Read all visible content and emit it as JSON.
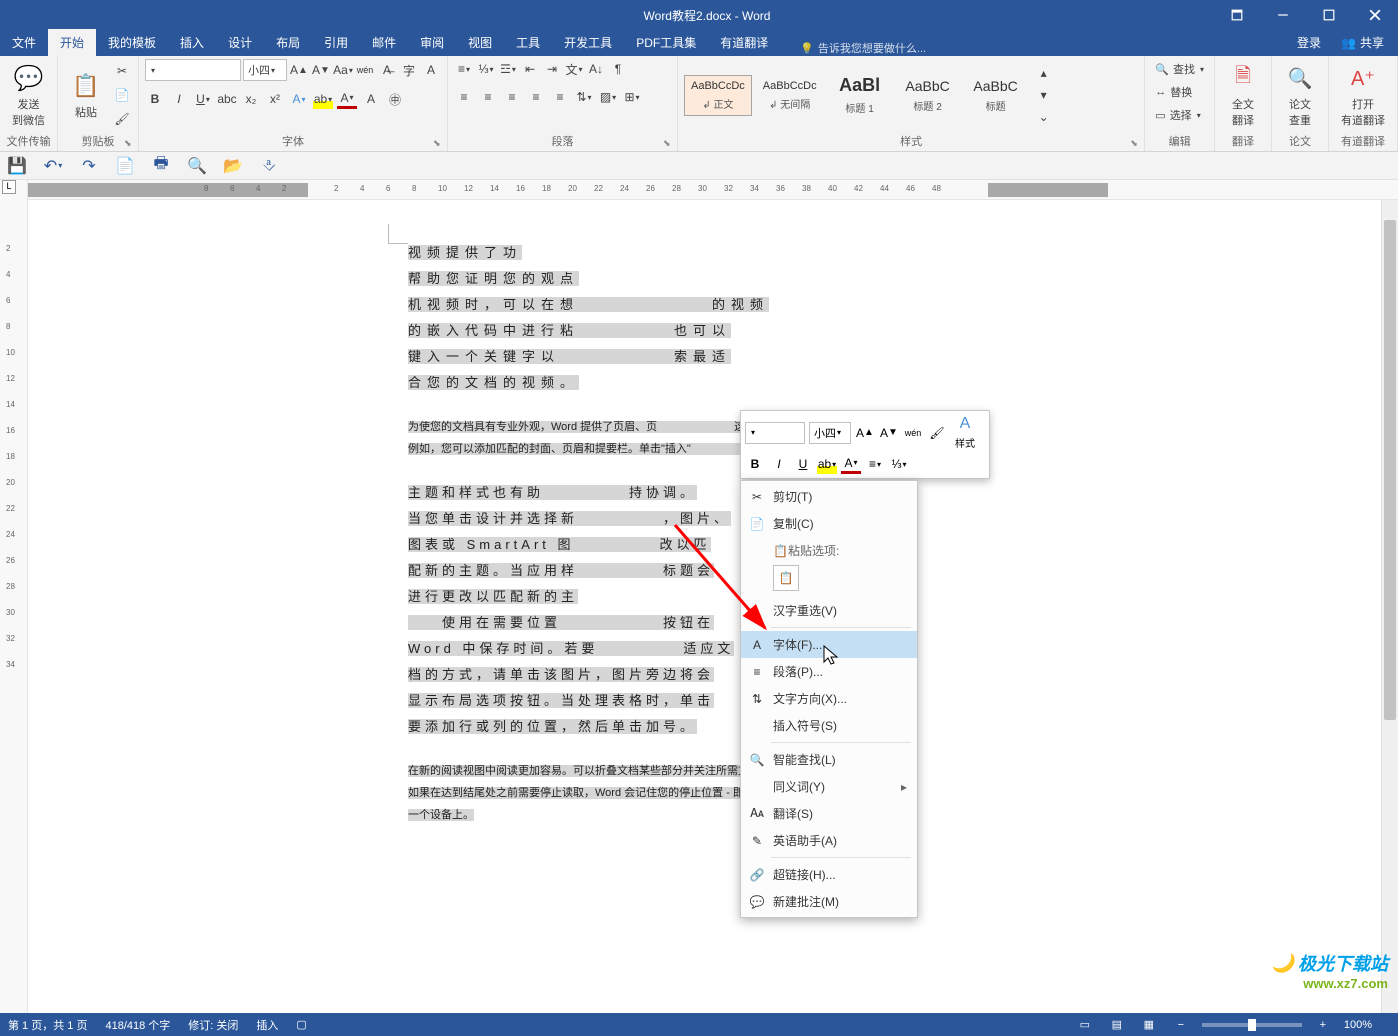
{
  "title": "Word教程2.docx - Word",
  "tabs": {
    "file": "文件",
    "home": "开始",
    "templates": "我的模板",
    "insert": "插入",
    "design": "设计",
    "layout": "布局",
    "references": "引用",
    "mailings": "邮件",
    "review": "审阅",
    "view": "视图",
    "tools": "工具",
    "devtools": "开发工具",
    "pdf": "PDF工具集",
    "youdao": "有道翻译"
  },
  "tell_me": "告诉我您想要做什么...",
  "login": "登录",
  "share": "共享",
  "ribbon": {
    "send_wechat": "发送\n到微信",
    "file_transfer": "文件传输",
    "paste": "粘贴",
    "clipboard": "剪贴板",
    "font_name": "",
    "font_size": "小四",
    "font_group": "字体",
    "para_group": "段落",
    "style_group": "样式",
    "edit_group": "编辑",
    "fulltext_trans": "全文\n翻译",
    "thesis_check": "论文\n查重",
    "open_youdao": "打开\n有道翻译",
    "translate": "翻译",
    "thesis": "论文",
    "youdao_grp": "有道翻译",
    "find": "查找",
    "replace": "替换",
    "select": "选择",
    "styles": {
      "normal": {
        "preview": "AaBbCcDc",
        "name": "↲ 正文"
      },
      "nospace": {
        "preview": "AaBbCcDc",
        "name": "↲ 无间隔"
      },
      "h1": {
        "preview": "AaBl",
        "name": "标题 1"
      },
      "h2": {
        "preview": "AaBbC",
        "name": "标题 2"
      },
      "title": {
        "preview": "AaBbC",
        "name": "标题"
      }
    }
  },
  "mini": {
    "font_name": "",
    "font_size": "小四",
    "styles_label": "样式"
  },
  "context_menu": {
    "cut": "剪切(T)",
    "copy": "复制(C)",
    "paste_options": "粘贴选项:",
    "han_reselect": "汉字重选(V)",
    "font": "字体(F)...",
    "paragraph": "段落(P)...",
    "text_direction": "文字方向(X)...",
    "insert_symbol": "插入符号(S)",
    "smart_lookup": "智能查找(L)",
    "synonyms": "同义词(Y)",
    "translate": "翻译(S)",
    "english_assistant": "英语助手(A)",
    "hyperlink": "超链接(H)...",
    "new_comment": "新建批注(M)"
  },
  "doc": {
    "p1": "视频提供了功\n帮助您证明您的观点\n机视频时，可以在想　　　　　　　的视频\n的嵌入代码中进行粘　　　　　也可以\n键入一个关键字以　　　　　　索最适\n合您的文档的视频。",
    "p2": "为使您的文档具有专业外观，Word 提供了页眉、页　　　　　　　这些设计可互为补充。\n例如，您可以添加匹配的封面、页眉和提要栏。单击\"插入\"　　　　　　　所需元素。",
    "p3": "主题和样式也有助　　　　　持协调。\n当您单击设计并选择新　　　　　，图片、\n图表或 SmartArt 图　　　　　改以匹\n配新的主题。当应用样　　　　　标题会\n进行更改以匹配新的主\n　　使用在需要位置　　　　　　按钮在\nWord 中保存时间。若要　　　　　适应文\n档的方式，请单击该图片，图片旁边将会\n显示布局选项按钮。当处理表格时，单击\n要添加行或列的位置，然后单击加号。",
    "p4": "在新的阅读视图中阅读更加容易。可以折叠文档某些部分并关注所需文本。\n如果在达到结尾处之前需要停止读取，Word 会记住您的停止位置 - 即使在另\n一个设备上。"
  },
  "ruler_h": [
    "8",
    "6",
    "4",
    "2",
    "",
    "2",
    "4",
    "6",
    "8",
    "10",
    "12",
    "14",
    "16",
    "18",
    "20",
    "22",
    "24",
    "26",
    "28",
    "30",
    "32",
    "34",
    "36",
    "38",
    "40",
    "42",
    "44",
    "46",
    "48"
  ],
  "ruler_v": [
    "",
    "2",
    "4",
    "6",
    "8",
    "10",
    "12",
    "14",
    "16",
    "18",
    "20",
    "22",
    "24",
    "26",
    "28",
    "30",
    "32",
    "34"
  ],
  "status": {
    "page": "第 1 页，共 1 页",
    "words": "418/418 个字",
    "track": "修订: 关闭",
    "insert": "插入",
    "zoom": "100%"
  },
  "watermark": {
    "line1": "极光下载站",
    "line2": "www.xz7.com"
  }
}
